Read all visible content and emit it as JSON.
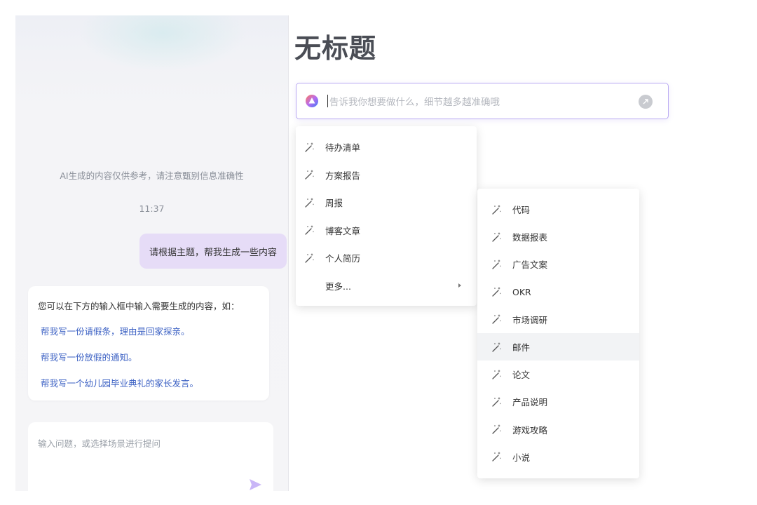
{
  "document": {
    "title": "无标题"
  },
  "ai_input": {
    "placeholder": "告诉我你想要做什么，细节越多越准确哦"
  },
  "menu_main": {
    "items": [
      {
        "label": "待办清单",
        "icon": "magic-wand-icon"
      },
      {
        "label": "方案报告",
        "icon": "magic-wand-icon"
      },
      {
        "label": "周报",
        "icon": "magic-wand-icon"
      },
      {
        "label": "博客文章",
        "icon": "magic-wand-icon"
      },
      {
        "label": "个人简历",
        "icon": "magic-wand-icon"
      }
    ],
    "more_label": "更多..."
  },
  "menu_sub": {
    "items": [
      {
        "label": "代码"
      },
      {
        "label": "数据报表"
      },
      {
        "label": "广告文案"
      },
      {
        "label": "OKR"
      },
      {
        "label": "市场调研"
      },
      {
        "label": "邮件"
      },
      {
        "label": "论文"
      },
      {
        "label": "产品说明"
      },
      {
        "label": "游戏攻略"
      },
      {
        "label": "小说"
      }
    ],
    "highlighted": "邮件"
  },
  "chat": {
    "disclaimer": "AI生成的内容仅供参考，请注意甄别信息准确性",
    "timestamp": "11:37",
    "user_message": "请根据主题，帮我生成一些内容",
    "ai_intro": "您可以在下方的输入框中输入需要生成的内容，如：",
    "suggestions": [
      "帮我写一份请假条，理由是回家探亲。",
      "帮我写一份放假的通知。",
      "帮我写一个幼儿园毕业典礼的家长发言。"
    ],
    "input_placeholder": "输入问题，或选择场景进行提问"
  },
  "colors": {
    "accent_purple": "#9b7bf0",
    "link_blue": "#3d62c4",
    "user_bubble": "#e6dcf7"
  }
}
